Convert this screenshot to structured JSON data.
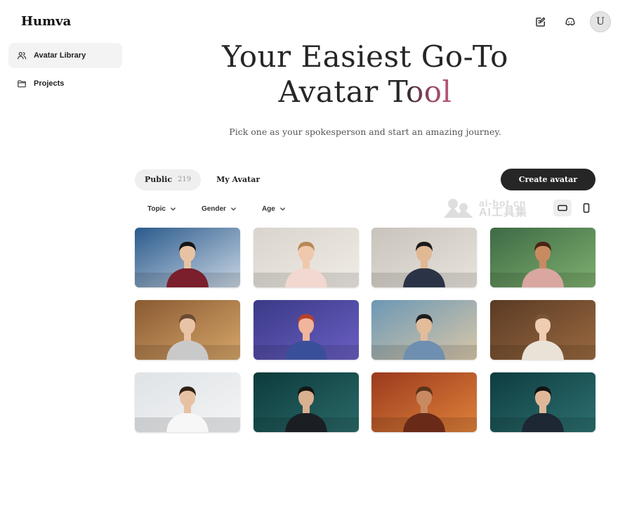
{
  "app": {
    "name": "Humva"
  },
  "sidebar": {
    "items": [
      {
        "label": "Avatar Library",
        "icon": "users-icon",
        "active": true
      },
      {
        "label": "Projects",
        "icon": "folder-icon",
        "active": false
      }
    ]
  },
  "header": {
    "icons": [
      "edit-note-icon",
      "discord-icon"
    ],
    "avatar_initial": "U"
  },
  "hero": {
    "title_line1": "Your Easiest Go-To",
    "title_line2_plain": "Avatar T",
    "title_line2_accent": "ool",
    "subtitle": "Pick one as your spokesperson and start an amazing journey."
  },
  "tabs": [
    {
      "label": "Public",
      "count": "219",
      "active": true
    },
    {
      "label": "My Avatar",
      "count": "",
      "active": false
    }
  ],
  "create_button": {
    "label": "Create avatar"
  },
  "filters": [
    {
      "label": "Topic"
    },
    {
      "label": "Gender"
    },
    {
      "label": "Age"
    }
  ],
  "watermark": {
    "line1": "ai-bot.cn",
    "line2": "AI工具集"
  },
  "view_modes": [
    "landscape-view-icon",
    "portrait-view-icon"
  ],
  "avatars": [
    {
      "scene": "news-studio",
      "bg": "#2a5a8c",
      "bg2": "#c9d6e3",
      "skin": "#e7c3a4",
      "hair": "#151515",
      "outfit": "#7a1f2b"
    },
    {
      "scene": "gym",
      "bg": "#d9d4cc",
      "bg2": "#f0ece6",
      "skin": "#efc8ad",
      "hair": "#b88957",
      "outfit": "#f2d8d0"
    },
    {
      "scene": "living-room",
      "bg": "#c8c3bb",
      "bg2": "#e8e3dc",
      "skin": "#e0b894",
      "hair": "#1a1a1a",
      "outfit": "#2b3446"
    },
    {
      "scene": "cartoon-room",
      "bg": "#3d6a45",
      "bg2": "#7fb06e",
      "skin": "#c98a62",
      "hair": "#4a2414",
      "outfit": "#d9a7a0"
    },
    {
      "scene": "warm-office",
      "bg": "#8a5a32",
      "bg2": "#d6a66a",
      "skin": "#e8c3a5",
      "hair": "#6b4a32",
      "outfit": "#c9c9c9"
    },
    {
      "scene": "neon-room",
      "bg": "#3a3a86",
      "bg2": "#6a5fc4",
      "skin": "#f0b59a",
      "hair": "#b8402a",
      "outfit": "#3a4f9a"
    },
    {
      "scene": "coastal-town",
      "bg": "#6c98b5",
      "bg2": "#d9c7a8",
      "skin": "#e3bc9a",
      "hair": "#1c1c1c",
      "outfit": "#6e8fb0"
    },
    {
      "scene": "library",
      "bg": "#5a3a24",
      "bg2": "#9a6a40",
      "skin": "#efcdb2",
      "hair": "#7a5535",
      "outfit": "#e9e2d6"
    },
    {
      "scene": "clinic",
      "bg": "#dfe3e6",
      "bg2": "#f3f4f5",
      "skin": "#e7c2a2",
      "hair": "#2e2217",
      "outfit": "#f7f7f7"
    },
    {
      "scene": "teal-studio",
      "bg": "#0d3a3c",
      "bg2": "#2a6a68",
      "skin": "#d9b090",
      "hair": "#141414",
      "outfit": "#1b1f24"
    },
    {
      "scene": "canyon",
      "bg": "#9a3a1e",
      "bg2": "#e0823a",
      "skin": "#c98a62",
      "hair": "#5a3418",
      "outfit": "#6a2a18"
    },
    {
      "scene": "teal-studio-2",
      "bg": "#0e3c40",
      "bg2": "#2d7070",
      "skin": "#e0b898",
      "hair": "#121212",
      "outfit": "#1e2734"
    }
  ]
}
